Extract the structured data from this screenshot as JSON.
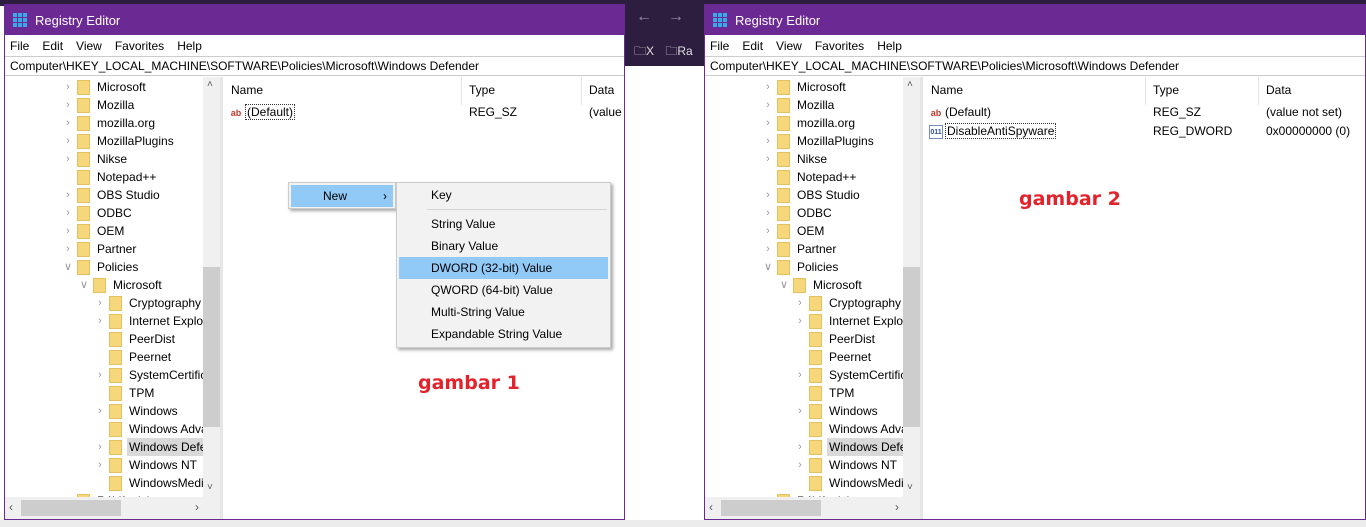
{
  "browser": {
    "bookmarks": [
      "X",
      "Ra"
    ]
  },
  "windows": [
    {
      "title": "Registry Editor",
      "menu": [
        "File",
        "Edit",
        "View",
        "Favorites",
        "Help"
      ],
      "address": "Computer\\HKEY_LOCAL_MACHINE\\SOFTWARE\\Policies\\Microsoft\\Windows Defender",
      "tree": [
        {
          "label": "Microsoft",
          "level": 1,
          "chev": "right"
        },
        {
          "label": "Mozilla",
          "level": 1,
          "chev": "right"
        },
        {
          "label": "mozilla.org",
          "level": 1,
          "chev": "right"
        },
        {
          "label": "MozillaPlugins",
          "level": 1,
          "chev": "right"
        },
        {
          "label": "Nikse",
          "level": 1,
          "chev": "right"
        },
        {
          "label": "Notepad++",
          "level": 1,
          "chev": "none"
        },
        {
          "label": "OBS Studio",
          "level": 1,
          "chev": "right"
        },
        {
          "label": "ODBC",
          "level": 1,
          "chev": "right"
        },
        {
          "label": "OEM",
          "level": 1,
          "chev": "right"
        },
        {
          "label": "Partner",
          "level": 1,
          "chev": "right"
        },
        {
          "label": "Policies",
          "level": 1,
          "chev": "down"
        },
        {
          "label": "Microsoft",
          "level": 2,
          "chev": "down"
        },
        {
          "label": "Cryptography",
          "level": 3,
          "chev": "right"
        },
        {
          "label": "Internet Explor",
          "level": 3,
          "chev": "right"
        },
        {
          "label": "PeerDist",
          "level": 3,
          "chev": "none"
        },
        {
          "label": "Peernet",
          "level": 3,
          "chev": "none"
        },
        {
          "label": "SystemCertific",
          "level": 3,
          "chev": "right"
        },
        {
          "label": "TPM",
          "level": 3,
          "chev": "none"
        },
        {
          "label": "Windows",
          "level": 3,
          "chev": "right"
        },
        {
          "label": "Windows Adva",
          "level": 3,
          "chev": "none"
        },
        {
          "label": "Windows Defe",
          "level": 3,
          "chev": "right",
          "selected": true
        },
        {
          "label": "Windows NT",
          "level": 3,
          "chev": "right"
        },
        {
          "label": "WindowsMedi",
          "level": 3,
          "chev": "none"
        },
        {
          "label": "RAVAntivirus",
          "level": 1,
          "chev": "none"
        }
      ],
      "columns": [
        "Name",
        "Type",
        "Data"
      ],
      "values": [
        {
          "name": "(Default)",
          "type": "REG_SZ",
          "data": "(value",
          "icon": "string-value-icon"
        }
      ],
      "context_menu": {
        "item": "New",
        "submenu": [
          "Key",
          "String Value",
          "Binary Value",
          "DWORD (32-bit) Value",
          "QWORD (64-bit) Value",
          "Multi-String Value",
          "Expandable String Value"
        ],
        "highlighted": "DWORD (32-bit) Value"
      },
      "caption": "gambar 1"
    },
    {
      "title": "Registry Editor",
      "menu": [
        "File",
        "Edit",
        "View",
        "Favorites",
        "Help"
      ],
      "address": "Computer\\HKEY_LOCAL_MACHINE\\SOFTWARE\\Policies\\Microsoft\\Windows Defender",
      "tree": [
        {
          "label": "Microsoft",
          "level": 1,
          "chev": "right"
        },
        {
          "label": "Mozilla",
          "level": 1,
          "chev": "right"
        },
        {
          "label": "mozilla.org",
          "level": 1,
          "chev": "right"
        },
        {
          "label": "MozillaPlugins",
          "level": 1,
          "chev": "right"
        },
        {
          "label": "Nikse",
          "level": 1,
          "chev": "right"
        },
        {
          "label": "Notepad++",
          "level": 1,
          "chev": "none"
        },
        {
          "label": "OBS Studio",
          "level": 1,
          "chev": "right"
        },
        {
          "label": "ODBC",
          "level": 1,
          "chev": "right"
        },
        {
          "label": "OEM",
          "level": 1,
          "chev": "right"
        },
        {
          "label": "Partner",
          "level": 1,
          "chev": "right"
        },
        {
          "label": "Policies",
          "level": 1,
          "chev": "down"
        },
        {
          "label": "Microsoft",
          "level": 2,
          "chev": "down"
        },
        {
          "label": "Cryptography",
          "level": 3,
          "chev": "right"
        },
        {
          "label": "Internet Explor",
          "level": 3,
          "chev": "right"
        },
        {
          "label": "PeerDist",
          "level": 3,
          "chev": "none"
        },
        {
          "label": "Peernet",
          "level": 3,
          "chev": "none"
        },
        {
          "label": "SystemCertific",
          "level": 3,
          "chev": "right"
        },
        {
          "label": "TPM",
          "level": 3,
          "chev": "none"
        },
        {
          "label": "Windows",
          "level": 3,
          "chev": "right"
        },
        {
          "label": "Windows Adva",
          "level": 3,
          "chev": "none"
        },
        {
          "label": "Windows Defe",
          "level": 3,
          "chev": "right",
          "selected": true
        },
        {
          "label": "Windows NT",
          "level": 3,
          "chev": "right"
        },
        {
          "label": "WindowsMedi",
          "level": 3,
          "chev": "none"
        },
        {
          "label": "RAVAntivirus",
          "level": 1,
          "chev": "none"
        }
      ],
      "columns": [
        "Name",
        "Type",
        "Data"
      ],
      "values": [
        {
          "name": "(Default)",
          "type": "REG_SZ",
          "data": "(value not set)",
          "icon": "string-value-icon"
        },
        {
          "name": "DisableAntiSpyware",
          "type": "REG_DWORD",
          "data": "0x00000000 (0)",
          "icon": "binary-value-icon",
          "focused": true
        }
      ],
      "caption": "gambar 2"
    }
  ],
  "colors": {
    "titlebar": "#6b2a93",
    "highlight": "#91c9f7",
    "caption": "#e3222b",
    "folder": "#f6d77c"
  }
}
